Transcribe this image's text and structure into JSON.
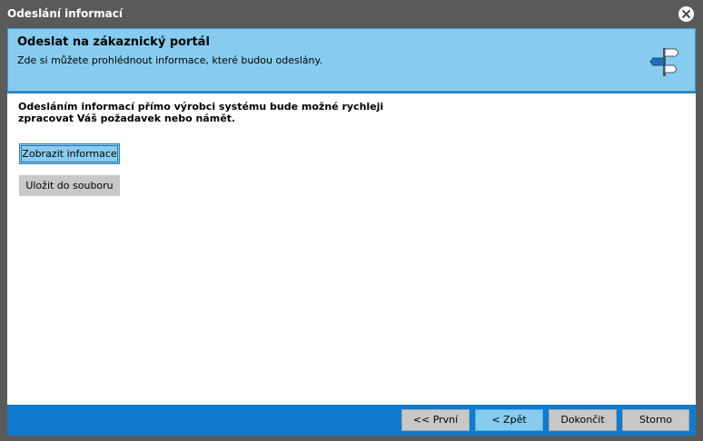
{
  "window": {
    "title": "Odeslání informací"
  },
  "header": {
    "title": "Odeslat na zákaznický portál",
    "subtitle": "Zde si můžete prohlédnout informace, které budou odeslány.",
    "icon": "signpost-icon"
  },
  "content": {
    "intro_line1": "Odesláním informací přímo výrobci systému bude možné rychleji",
    "intro_line2": "zpracovat Váš požadavek nebo námět.",
    "show_info_label": "Zobrazit informace",
    "save_to_file_label": "Uložit do souboru"
  },
  "footer": {
    "first_label": "<< První",
    "back_label": "< Zpět",
    "finish_label": "Dokončit",
    "cancel_label": "Storno"
  },
  "colors": {
    "titlebar": "#5a5a5a",
    "header_bg": "#87ccef",
    "accent": "#0e7ad0",
    "button_gray": "#c8c8c8"
  }
}
